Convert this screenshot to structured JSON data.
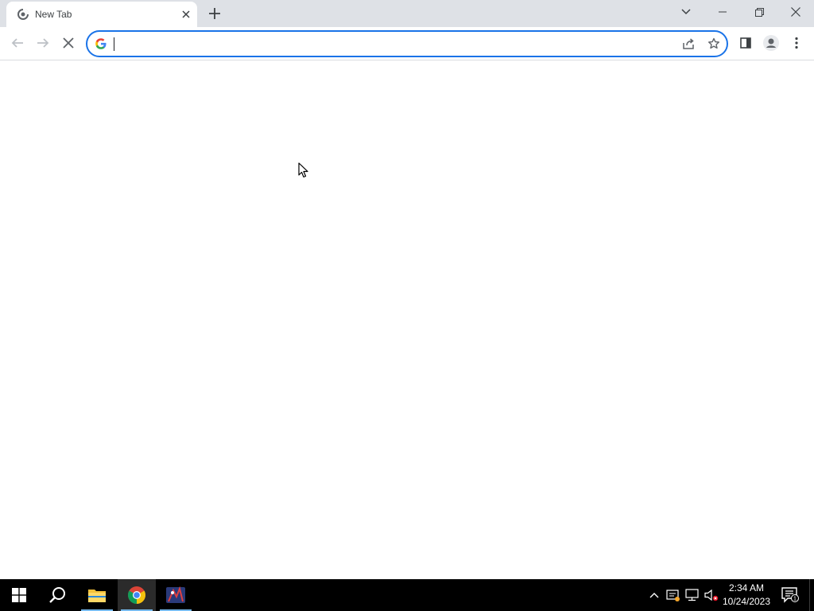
{
  "browser": {
    "tab": {
      "title": "New Tab",
      "favicon": "chrome-loading-icon"
    },
    "new_tab_label": "+",
    "window_controls": [
      "tab-search-icon",
      "minimize-icon",
      "restore-icon",
      "close-icon"
    ],
    "toolbar": {
      "back_icon": "arrow-left-icon",
      "forward_icon": "arrow-right-icon",
      "stop_icon": "close-icon",
      "omnibox": {
        "value": "",
        "placeholder": "",
        "leading_icon": "google-g-icon"
      },
      "share_icon": "share-icon",
      "bookmark_icon": "star-icon",
      "side_panel_icon": "side-panel-icon",
      "profile_icon": "avatar-icon",
      "menu_icon": "kebab-menu-icon"
    },
    "accent_color": "#1a73e8"
  },
  "taskbar": {
    "apps": [
      "windows-start-icon",
      "search-icon",
      "file-explorer-icon",
      "chrome-icon",
      "app-icon"
    ],
    "clock": {
      "time": "2:34 AM",
      "date": "10/24/2023"
    },
    "notification_count": "1",
    "tray_icons": [
      "chevron-up-icon",
      "security-icon",
      "network-icon",
      "volume-muted-icon"
    ]
  }
}
